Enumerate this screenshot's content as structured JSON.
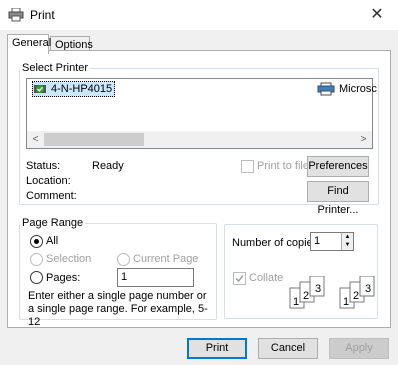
{
  "window": {
    "title": "Print",
    "close_glyph": "✕"
  },
  "tabs": [
    {
      "label": "General"
    },
    {
      "label": "Options"
    }
  ],
  "select_printer": {
    "legend": "Select Printer",
    "printers": [
      {
        "name": "4-N-HP4015"
      },
      {
        "name": "Microsc"
      }
    ],
    "scroll_left": "<",
    "scroll_right": ">"
  },
  "status": {
    "status_label": "Status:",
    "status_value": "Ready",
    "location_label": "Location:",
    "comment_label": "Comment:",
    "print_to_file_label": "Print to file",
    "preferences_button": "Preferences",
    "find_printer_button": "Find Printer..."
  },
  "page_range": {
    "legend": "Page Range",
    "all_label": "All",
    "selection_label": "Selection",
    "current_page_label": "Current Page",
    "pages_label": "Pages:",
    "pages_value": "1",
    "hint": "Enter either a single page number or a single page range.  For example, 5-12"
  },
  "copies": {
    "label": "Number of copies:",
    "value": "1",
    "collate_label": "Collate"
  },
  "footer": {
    "print": "Print",
    "cancel": "Cancel",
    "apply": "Apply"
  }
}
